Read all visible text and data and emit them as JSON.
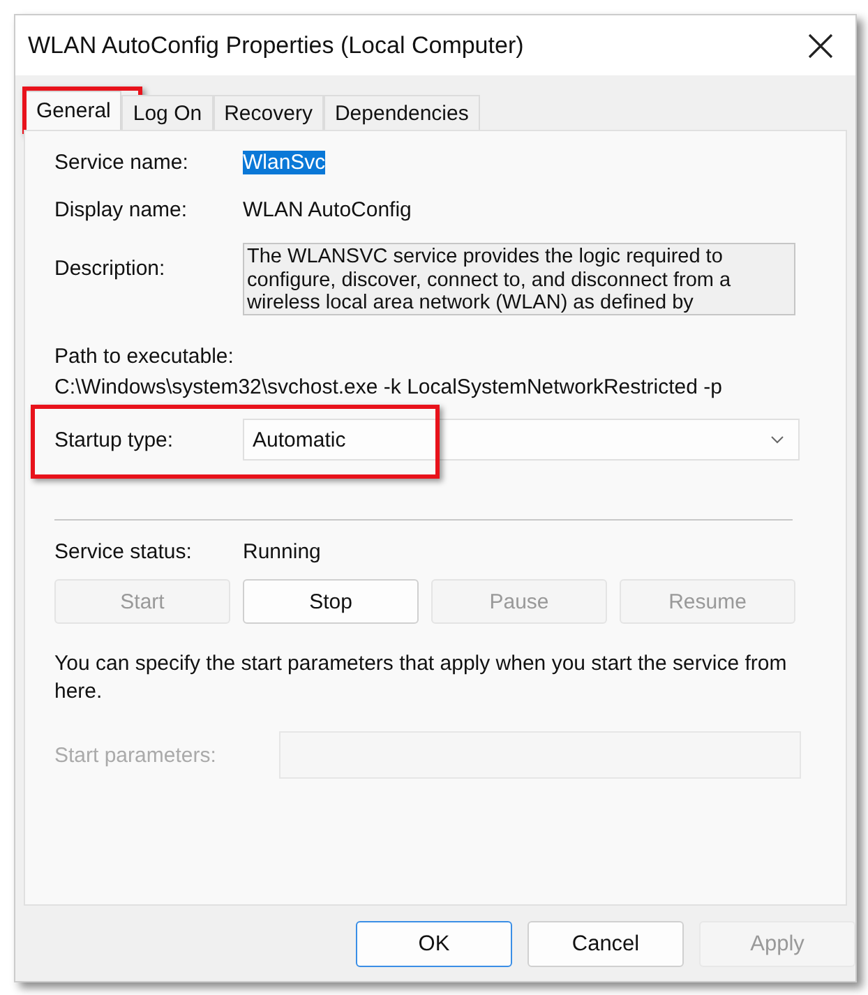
{
  "window": {
    "title": "WLAN AutoConfig Properties (Local Computer)"
  },
  "tabs": [
    {
      "label": "General",
      "selected": true,
      "highlighted": true
    },
    {
      "label": "Log On",
      "selected": false,
      "highlighted": false
    },
    {
      "label": "Recovery",
      "selected": false,
      "highlighted": false
    },
    {
      "label": "Dependencies",
      "selected": false,
      "highlighted": false
    }
  ],
  "service_name": {
    "label": "Service name:",
    "value": "WlanSvc",
    "selected": true
  },
  "display_name": {
    "label": "Display name:",
    "value": "WLAN AutoConfig"
  },
  "description": {
    "label": "Description:",
    "value": "The WLANSVC service provides the logic required to configure, discover, connect to, and disconnect from a wireless local area network (WLAN) as defined by"
  },
  "path": {
    "label": "Path to executable:",
    "value": "C:\\Windows\\system32\\svchost.exe -k LocalSystemNetworkRestricted -p"
  },
  "startup_type": {
    "label": "Startup type:",
    "value": "Automatic",
    "highlighted": true
  },
  "service_status": {
    "label": "Service status:",
    "value": "Running"
  },
  "service_buttons": [
    {
      "label": "Start",
      "disabled": true
    },
    {
      "label": "Stop",
      "disabled": false
    },
    {
      "label": "Pause",
      "disabled": true
    },
    {
      "label": "Resume",
      "disabled": true
    }
  ],
  "hint": "You can specify the start parameters that apply when you start the service from here.",
  "start_parameters": {
    "label": "Start parameters:",
    "disabled": true
  },
  "buttons": [
    {
      "label": "OK",
      "disabled": false,
      "default": true
    },
    {
      "label": "Cancel",
      "disabled": false,
      "default": false
    },
    {
      "label": "Apply",
      "disabled": true,
      "default": false
    }
  ]
}
